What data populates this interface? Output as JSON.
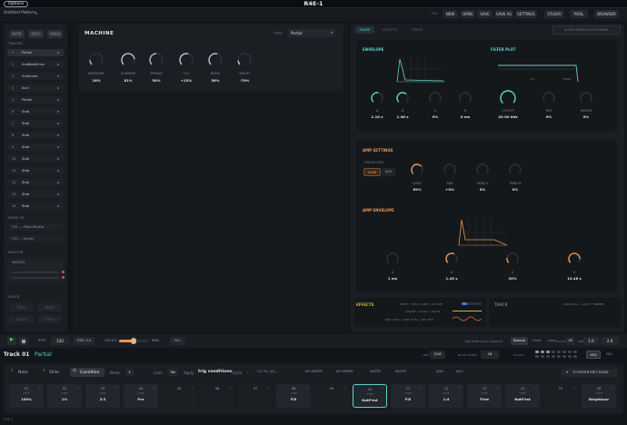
{
  "app": {
    "title": "R4E-1",
    "options_label": "Options",
    "pattern_name": "Untitled Pattern",
    "status_text": "R4E-1"
  },
  "topbar": {
    "file_label": "FILE",
    "buttons": [
      "NEW",
      "OPEN",
      "SAVE",
      "SAVE AS",
      "SETTINGS",
      "STUDIO",
      "POOL",
      "BROWSER"
    ]
  },
  "sidebar": {
    "mode_buttons": [
      "MATE",
      "DRIO",
      "VIDEO"
    ],
    "tracks_header": "TRACKS",
    "tracks": [
      {
        "num": "1",
        "name": "Partial"
      },
      {
        "num": "2",
        "name": "AnaBassDrum"
      },
      {
        "num": "3",
        "name": "AnaSnare"
      },
      {
        "num": "4",
        "name": "Acid"
      },
      {
        "num": "5",
        "name": "Partial"
      },
      {
        "num": "6",
        "name": "Stab"
      },
      {
        "num": "7",
        "name": "Stab"
      },
      {
        "num": "8",
        "name": "Stab"
      },
      {
        "num": "9",
        "name": "Stab"
      },
      {
        "num": "10",
        "name": "Stab"
      },
      {
        "num": "11",
        "name": "Stab"
      },
      {
        "num": "12",
        "name": "Stab"
      },
      {
        "num": "13",
        "name": "Stab"
      },
      {
        "num": "14",
        "name": "Stab"
      }
    ],
    "send_header": "SEND FX",
    "sends": [
      "FX1 — Plate Reverb",
      "FX2 — Empty"
    ],
    "master_header": "MASTER",
    "master_label": "MASTER",
    "voice_header": "VOICE",
    "voice_buttons": [
      "Prev",
      "Next",
      "Learn",
      "Clone"
    ]
  },
  "machine": {
    "title": "MACHINE",
    "type_label": "TYPE",
    "type_value": "Partial",
    "knobs": [
      {
        "label": "HARMONIC",
        "value": "16%"
      },
      {
        "label": "SHIMMER",
        "value": "81%"
      },
      {
        "label": "SPREAD",
        "value": "50%"
      },
      {
        "label": "TILT",
        "value": "+15%"
      },
      {
        "label": "NOISE",
        "value": "56%"
      },
      {
        "label": "WIDTH",
        "value": "-70%"
      }
    ]
  },
  "tabs": [
    "SHAPE",
    "EFFECTS",
    "TRACK"
  ],
  "modulation_button": "SHOW MODULATION PANEL",
  "envelope": {
    "title": "ENVELOPE",
    "knobs": [
      {
        "label": "A",
        "value": "1.10 s"
      },
      {
        "label": "D",
        "value": "1.48 s"
      },
      {
        "label": "S",
        "value": "0%"
      },
      {
        "label": "R",
        "value": "0 ms"
      }
    ]
  },
  "filter_plot": {
    "title": "FILTER PLOT",
    "lp_label": "LP",
    "peak_label": "PEAK",
    "knobs": [
      {
        "label": "CUTOFF",
        "value": "20.00 kHz"
      },
      {
        "label": "RES",
        "value": "0%"
      },
      {
        "label": "MORPH",
        "value": "0%"
      }
    ]
  },
  "amp_settings": {
    "title": "AMP SETTINGS",
    "envelope_label": "ENVELOPE",
    "modes": [
      "ADSR",
      "ASD"
    ],
    "knobs": [
      {
        "label": "LEVEL",
        "value": "69%"
      },
      {
        "label": "PAN",
        "value": "+0%"
      },
      {
        "label": "SEND A",
        "value": "0%"
      },
      {
        "label": "SEND B",
        "value": "0%"
      }
    ]
  },
  "amp_envelope": {
    "title": "AMP ENVELOPE",
    "knobs": [
      {
        "label": "A",
        "value": "1 ms"
      },
      {
        "label": "D",
        "value": "1.45 s"
      },
      {
        "label": "S",
        "value": "20%"
      },
      {
        "label": "R",
        "value": "10.46 s"
      }
    ]
  },
  "effects": {
    "title": "EFFECTS",
    "line1": "HEAT / FOLD AMP / ACTIVE",
    "line2": "LOOSE / LOUD / LOUD",
    "line3": "DRY 60% / WET 40% / DE-OFF",
    "track_label": "TRACK",
    "track_info": "VOL 80% / +0ST / 80BPM"
  },
  "transport": {
    "bpm_label": "BPM",
    "bpm_value": "120",
    "midi_label": "MIDI CLK",
    "swing_label": "SWING",
    "swing_value": "50%",
    "swing_level": 0.5,
    "fill_label": "FILL",
    "pattern_label": "PATTERN LOOP LENGTH",
    "modes": [
      "Natural",
      "Fixed",
      "Loop"
    ],
    "scale_label": "SCALE",
    "scale_value": "16",
    "speed_label": "SPEED",
    "speed_value": "1.0",
    "length_value": "2.0"
  },
  "track_header": {
    "track_name": "Track 01",
    "machine_name": "Partial",
    "len_label": "LEN",
    "len_value": "3/16",
    "base_label": "BASE STEPS",
    "base_value": "16",
    "scale_label": "SCALE",
    "seq_label": "SEQ",
    "mix_label": "MIX"
  },
  "editor": {
    "tabs": [
      "Note",
      "Slide",
      "Condition"
    ],
    "mode_label": "Mode",
    "mode_value": "4",
    "lane_label": "Lane",
    "lane_value": "Tab",
    "apply_label": "Apply",
    "apply_value": "trig conditions",
    "cycle_label": "Cycle",
    "chips": [
      "1:2, FIL, 4/4, ...",
      "A3+SH/STR",
      "A3+SH/PRE",
      "SH/STR",
      "SH/STD",
      "A/XA",
      "A/X1"
    ],
    "edit_button": "TO ENTER EDIT MODE"
  },
  "steps": [
    {
      "n": "01",
      "s": "STEP",
      "c": "100%"
    },
    {
      "n": "02",
      "s": "STEP",
      "c": "1%"
    },
    {
      "n": "03",
      "s": "STEP",
      "c": "2:3"
    },
    {
      "n": "04",
      "s": "STEP",
      "c": "Pre"
    },
    {
      "n": "05",
      "s": "",
      "c": ""
    },
    {
      "n": "06",
      "s": "",
      "c": ""
    },
    {
      "n": "07",
      "s": "",
      "c": ""
    },
    {
      "n": "08",
      "s": "STEP",
      "c": "Fill"
    },
    {
      "n": "09",
      "s": "",
      "c": ""
    },
    {
      "n": "10",
      "s": "STEP",
      "c": "NotFirst"
    },
    {
      "n": "11",
      "s": "STEP",
      "c": "Fill"
    },
    {
      "n": "12",
      "s": "STEP",
      "c": "1:4"
    },
    {
      "n": "13",
      "s": "STEP",
      "c": "First"
    },
    {
      "n": "14",
      "s": "STEP",
      "c": "NotFirst"
    },
    {
      "n": "15",
      "s": "",
      "c": ""
    },
    {
      "n": "16",
      "s": "STEP",
      "c": "Neighbour"
    }
  ],
  "colors": {
    "accent_teal": "#5fd0c8",
    "accent_orange": "#e3975a",
    "background": "#121519"
  }
}
